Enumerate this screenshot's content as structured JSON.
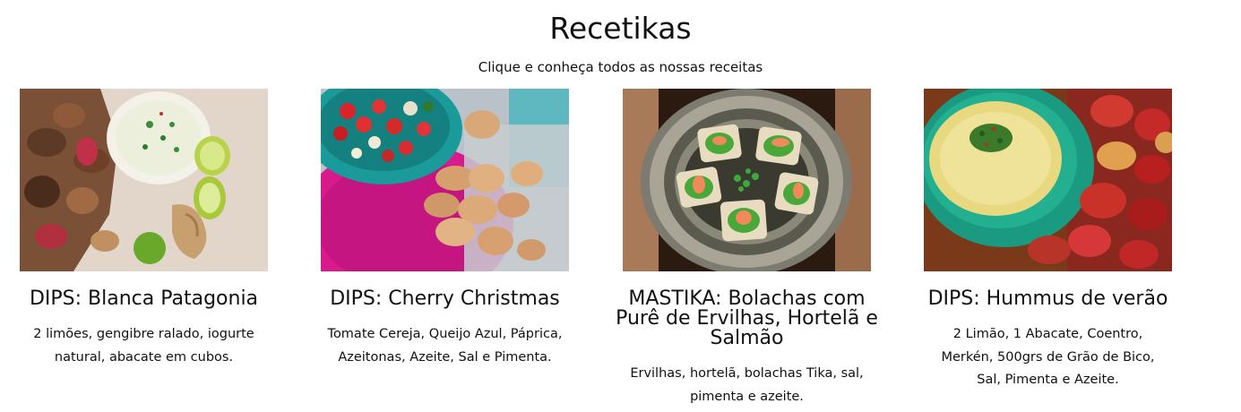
{
  "header": {
    "title": "Recetikas",
    "subtitle": "Clique e conheça todos as nossas receitas"
  },
  "recipes": [
    {
      "title": "DIPS: Blanca Patagonia",
      "description": "2 limões, gengibre ralado, iogurte natural, abacate em cubos.",
      "image_icon": "dip-blanca-photo"
    },
    {
      "title": "DIPS: Cherry Christmas",
      "description": "Tomate Cereja, Queijo Azul, Páprica, Azeitonas, Azeite, Sal e Pimenta.",
      "image_icon": "cherry-christmas-photo"
    },
    {
      "title": "MASTIKA: Bolachas com Purê de Ervilhas, Hortelã e Salmão",
      "description": "Ervilhas, hortelã, bolachas Tika, sal, pimenta e azeite.",
      "image_icon": "mastika-plate-photo"
    },
    {
      "title": "DIPS: Hummus de verão",
      "description": "2 Limão, 1 Abacate, Coentro, Merkén, 500grs de Grão de Bico, Sal, Pimenta e Azeite.",
      "image_icon": "hummus-photo"
    }
  ]
}
